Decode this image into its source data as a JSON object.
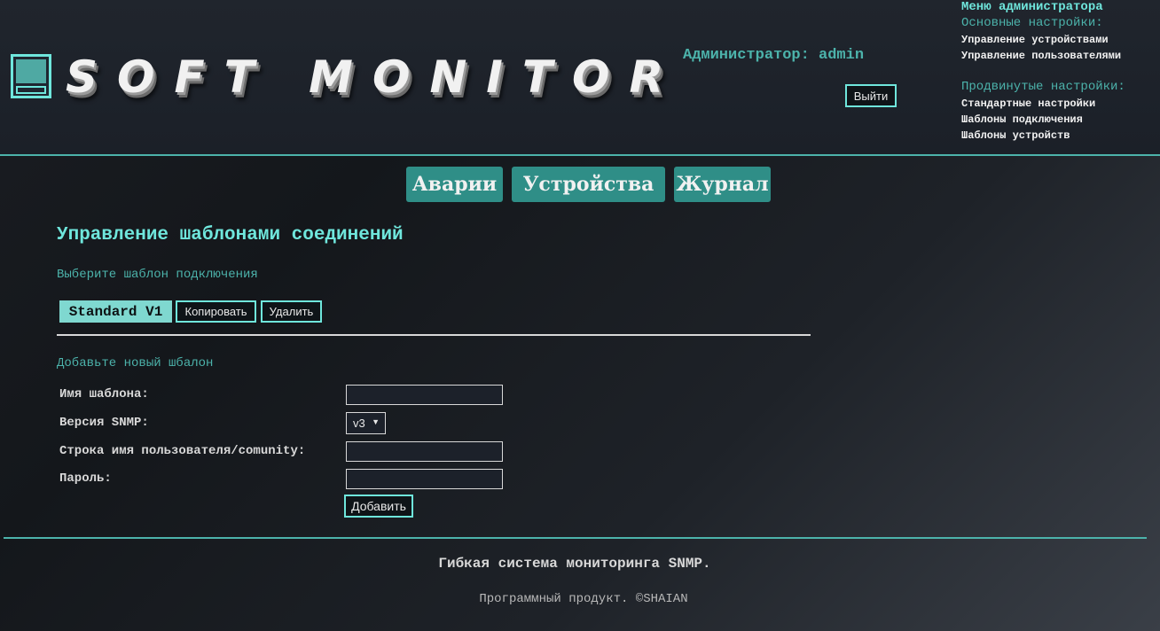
{
  "header": {
    "logo_text": "SOFT MONITOR",
    "admin_label": "Администратор: admin",
    "logout_label": "Выйти"
  },
  "admin_menu": {
    "title": "Меню администратора",
    "basic_heading": "Основные настройки:",
    "basic_items": [
      "Управление устройствами",
      "Управление пользователями"
    ],
    "advanced_heading": "Продвинутые настройки:",
    "advanced_items": [
      "Стандартные настройки",
      "Шаблоны подключения",
      "Шаблоны устройств"
    ]
  },
  "nav": {
    "items": [
      "Аварии",
      "Устройства",
      "Журнал"
    ]
  },
  "main": {
    "title": "Управление шаблонами соединений",
    "select_heading": "Выберите шаблон подключения",
    "selected_template": "Standard V1",
    "copy_label": "Копировать",
    "delete_label": "Удалить",
    "add_heading": "Добавьте новый шбалон"
  },
  "form": {
    "name_label": "Имя шаблона:",
    "snmp_label": "Версия SNMP:",
    "snmp_value": "v3",
    "user_label": "Строка имя пользователя/comunity:",
    "password_label": "Пароль:",
    "name_value": "",
    "user_value": "",
    "password_value": "",
    "add_label": "Добавить"
  },
  "footer": {
    "main": "Гибкая система мониторинга SNMP.",
    "copyright": "Программный продукт. ©SHAIAN"
  },
  "colors": {
    "accent": "#6fe6dc",
    "accent_dark": "#4cb3ab",
    "nav_bg": "#2f8e87",
    "selected_bg": "#7fd8d0"
  }
}
